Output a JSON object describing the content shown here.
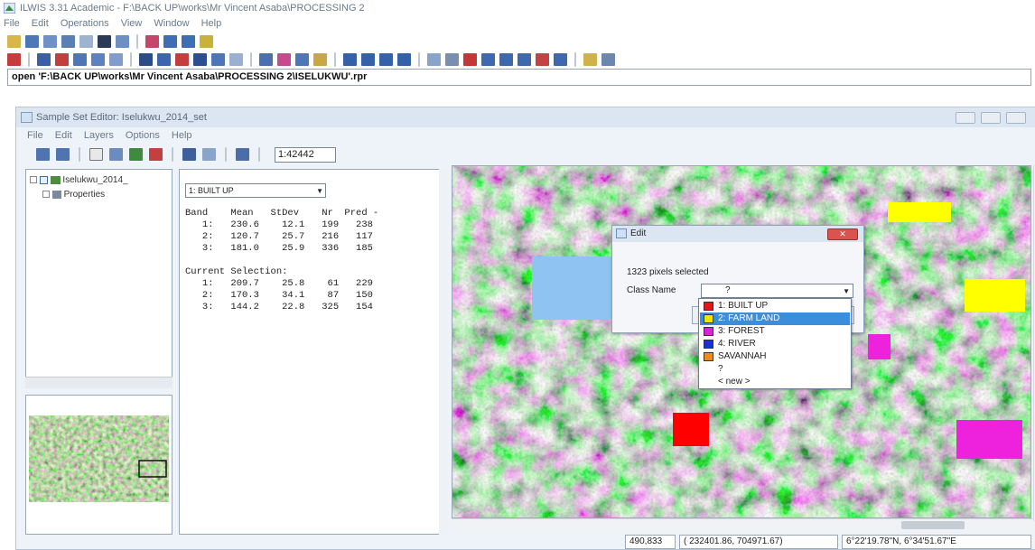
{
  "app": {
    "title": "ILWIS 3.31 Academic - F:\\BACK UP\\works\\Mr Vincent Asaba\\PROCESSING 2",
    "menu": [
      "File",
      "Edit",
      "Operations",
      "View",
      "Window",
      "Help"
    ],
    "command_line": "open 'F:\\BACK UP\\works\\Mr Vincent Asaba\\PROCESSING 2\\ISELUKWU'.rpr"
  },
  "sample_set_editor": {
    "title": "Sample Set Editor: Iselukwu_2014_set",
    "menu": [
      "File",
      "Edit",
      "Layers",
      "Options",
      "Help"
    ],
    "scale": "1:42442",
    "tree": {
      "root": "Iselukwu_2014_",
      "child": "Properties"
    }
  },
  "stats": {
    "selected_class": "1: BUILT UP",
    "header": "Band    Mean   StDev    Nr  Pred -",
    "rows": [
      "   1:   230.6    12.1   199   238",
      "   2:   120.7    25.7   216   117",
      "   3:   181.0    25.9   336   185"
    ],
    "selection_title": "Current Selection:",
    "selection_rows": [
      "   1:   209.7    25.8    61   229",
      "   2:   170.3    34.1    87   150",
      "   3:   144.2    22.8   325   154"
    ]
  },
  "status_bar": {
    "rowcol": "490,833",
    "coords": "( 232401.86,  704971.67)",
    "latlon": "6°22'19.78\"N, 6°34'51.67\"E"
  },
  "edit_dialog": {
    "title": "Edit",
    "pixels_selected": "1323 pixels selected",
    "class_name_label": "Class Name",
    "class_name_value": "?",
    "options": [
      {
        "label": "1: BUILT UP",
        "color": "#e8141b"
      },
      {
        "label": "2: FARM LAND",
        "color": "#f2e600"
      },
      {
        "label": "3: FOREST",
        "color": "#e020d8"
      },
      {
        "label": "4: RIVER",
        "color": "#1a2fd6"
      },
      {
        "label": "SAVANNAH",
        "color": "#f08a1c"
      },
      {
        "label": "?",
        "color": ""
      },
      {
        "label": "< new >",
        "color": ""
      }
    ],
    "selected_index": 1
  },
  "colors": {
    "built_up": "#ff0000",
    "farm_land": "#ffff00",
    "forest": "#ee22dd",
    "water_sample": "#8ec3f2",
    "selection_highlight": "#3b8edb"
  }
}
